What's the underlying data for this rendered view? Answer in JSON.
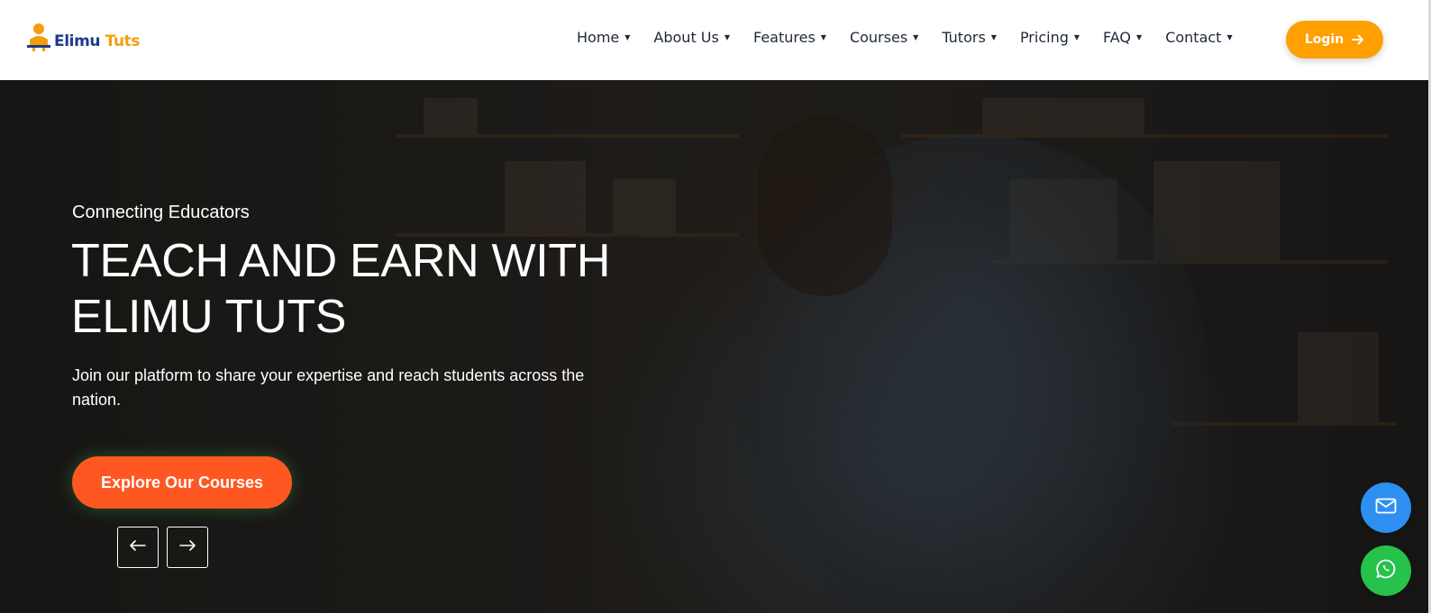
{
  "brand": {
    "name_part1": "Elimu",
    "name_part2": "Tuts",
    "primary_color": "#1d3a8a",
    "accent_color": "#f59e0b"
  },
  "nav": {
    "items": [
      {
        "label": "Home"
      },
      {
        "label": "About Us"
      },
      {
        "label": "Features"
      },
      {
        "label": "Courses"
      },
      {
        "label": "Tutors"
      },
      {
        "label": "Pricing"
      },
      {
        "label": "FAQ"
      },
      {
        "label": "Contact"
      }
    ],
    "caret_icon": "caret-down-icon",
    "login_label": "Login",
    "login_color": "#ff9f00"
  },
  "hero": {
    "eyebrow": "Connecting Educators",
    "headline": "TEACH AND EARN WITH ELIMU TUTS",
    "subtext": "Join our platform to share your expertise and reach students across the nation.",
    "cta_label": "Explore Our Courses",
    "cta_color": "#ff5722",
    "prev_icon": "arrow-left-icon",
    "next_icon": "arrow-right-icon"
  },
  "floating": {
    "mail_icon": "mail-icon",
    "mail_color": "#2d8ff0",
    "whatsapp_icon": "whatsapp-icon",
    "whatsapp_color": "#27c24c"
  }
}
